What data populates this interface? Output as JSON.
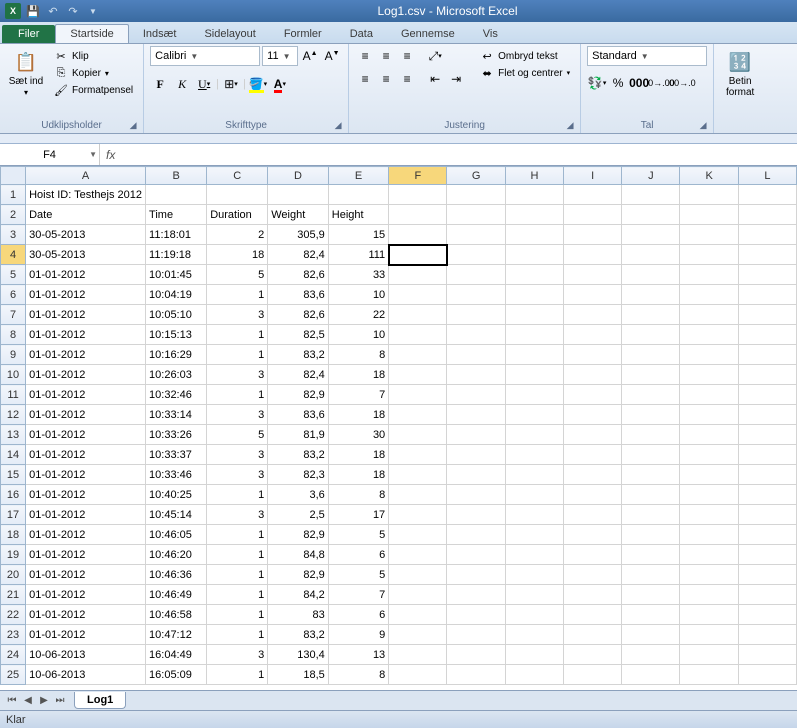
{
  "titlebar": {
    "title": "Log1.csv - Microsoft Excel"
  },
  "tabs": {
    "filer": "Filer",
    "startside": "Startside",
    "indsaet": "Indsæt",
    "sidelayout": "Sidelayout",
    "formler": "Formler",
    "data": "Data",
    "gennemse": "Gennemse",
    "vis": "Vis"
  },
  "ribbon": {
    "clipboard": {
      "paste": "Sæt ind",
      "cut": "Klip",
      "copy": "Kopier",
      "formatpainter": "Formatpensel",
      "label": "Udklipsholder"
    },
    "font": {
      "name": "Calibri",
      "size": "11",
      "label": "Skrifttype"
    },
    "alignment": {
      "wrap": "Ombryd tekst",
      "merge": "Flet og centrer",
      "label": "Justering"
    },
    "number": {
      "format": "Standard",
      "label": "Tal"
    },
    "styles": {
      "conditional": "Betin format"
    }
  },
  "namebox": "F4",
  "formula": "",
  "columns": [
    "A",
    "B",
    "C",
    "D",
    "E",
    "F",
    "G",
    "H",
    "I",
    "J",
    "K",
    "L"
  ],
  "selected_col_index": 5,
  "selected_row": 4,
  "rows": [
    {
      "n": 1,
      "c": [
        "Hoist ID: Testhejs 2012",
        "",
        "",
        "",
        "",
        "",
        "",
        "",
        "",
        "",
        "",
        ""
      ]
    },
    {
      "n": 2,
      "c": [
        "Date",
        "Time",
        "Duration",
        "Weight",
        "Height",
        "",
        "",
        "",
        "",
        "",
        "",
        ""
      ]
    },
    {
      "n": 3,
      "c": [
        "30-05-2013",
        "11:18:01",
        "2",
        "305,9",
        "15",
        "",
        "",
        "",
        "",
        "",
        "",
        ""
      ]
    },
    {
      "n": 4,
      "c": [
        "30-05-2013",
        "11:19:18",
        "18",
        "82,4",
        "111",
        "",
        "",
        "",
        "",
        "",
        "",
        ""
      ]
    },
    {
      "n": 5,
      "c": [
        "01-01-2012",
        "10:01:45",
        "5",
        "82,6",
        "33",
        "",
        "",
        "",
        "",
        "",
        "",
        ""
      ]
    },
    {
      "n": 6,
      "c": [
        "01-01-2012",
        "10:04:19",
        "1",
        "83,6",
        "10",
        "",
        "",
        "",
        "",
        "",
        "",
        ""
      ]
    },
    {
      "n": 7,
      "c": [
        "01-01-2012",
        "10:05:10",
        "3",
        "82,6",
        "22",
        "",
        "",
        "",
        "",
        "",
        "",
        ""
      ]
    },
    {
      "n": 8,
      "c": [
        "01-01-2012",
        "10:15:13",
        "1",
        "82,5",
        "10",
        "",
        "",
        "",
        "",
        "",
        "",
        ""
      ]
    },
    {
      "n": 9,
      "c": [
        "01-01-2012",
        "10:16:29",
        "1",
        "83,2",
        "8",
        "",
        "",
        "",
        "",
        "",
        "",
        ""
      ]
    },
    {
      "n": 10,
      "c": [
        "01-01-2012",
        "10:26:03",
        "3",
        "82,4",
        "18",
        "",
        "",
        "",
        "",
        "",
        "",
        ""
      ]
    },
    {
      "n": 11,
      "c": [
        "01-01-2012",
        "10:32:46",
        "1",
        "82,9",
        "7",
        "",
        "",
        "",
        "",
        "",
        "",
        ""
      ]
    },
    {
      "n": 12,
      "c": [
        "01-01-2012",
        "10:33:14",
        "3",
        "83,6",
        "18",
        "",
        "",
        "",
        "",
        "",
        "",
        ""
      ]
    },
    {
      "n": 13,
      "c": [
        "01-01-2012",
        "10:33:26",
        "5",
        "81,9",
        "30",
        "",
        "",
        "",
        "",
        "",
        "",
        ""
      ]
    },
    {
      "n": 14,
      "c": [
        "01-01-2012",
        "10:33:37",
        "3",
        "83,2",
        "18",
        "",
        "",
        "",
        "",
        "",
        "",
        ""
      ]
    },
    {
      "n": 15,
      "c": [
        "01-01-2012",
        "10:33:46",
        "3",
        "82,3",
        "18",
        "",
        "",
        "",
        "",
        "",
        "",
        ""
      ]
    },
    {
      "n": 16,
      "c": [
        "01-01-2012",
        "10:40:25",
        "1",
        "3,6",
        "8",
        "",
        "",
        "",
        "",
        "",
        "",
        ""
      ]
    },
    {
      "n": 17,
      "c": [
        "01-01-2012",
        "10:45:14",
        "3",
        "2,5",
        "17",
        "",
        "",
        "",
        "",
        "",
        "",
        ""
      ]
    },
    {
      "n": 18,
      "c": [
        "01-01-2012",
        "10:46:05",
        "1",
        "82,9",
        "5",
        "",
        "",
        "",
        "",
        "",
        "",
        ""
      ]
    },
    {
      "n": 19,
      "c": [
        "01-01-2012",
        "10:46:20",
        "1",
        "84,8",
        "6",
        "",
        "",
        "",
        "",
        "",
        "",
        ""
      ]
    },
    {
      "n": 20,
      "c": [
        "01-01-2012",
        "10:46:36",
        "1",
        "82,9",
        "5",
        "",
        "",
        "",
        "",
        "",
        "",
        ""
      ]
    },
    {
      "n": 21,
      "c": [
        "01-01-2012",
        "10:46:49",
        "1",
        "84,2",
        "7",
        "",
        "",
        "",
        "",
        "",
        "",
        ""
      ]
    },
    {
      "n": 22,
      "c": [
        "01-01-2012",
        "10:46:58",
        "1",
        "83",
        "6",
        "",
        "",
        "",
        "",
        "",
        "",
        ""
      ]
    },
    {
      "n": 23,
      "c": [
        "01-01-2012",
        "10:47:12",
        "1",
        "83,2",
        "9",
        "",
        "",
        "",
        "",
        "",
        "",
        ""
      ]
    },
    {
      "n": 24,
      "c": [
        "10-06-2013",
        "16:04:49",
        "3",
        "130,4",
        "13",
        "",
        "",
        "",
        "",
        "",
        "",
        ""
      ]
    },
    {
      "n": 25,
      "c": [
        "10-06-2013",
        "16:05:09",
        "1",
        "18,5",
        "8",
        "",
        "",
        "",
        "",
        "",
        "",
        ""
      ]
    }
  ],
  "numeric_cols": [
    2,
    3,
    4
  ],
  "sheet": {
    "name": "Log1"
  },
  "status": {
    "ready": "Klar"
  }
}
